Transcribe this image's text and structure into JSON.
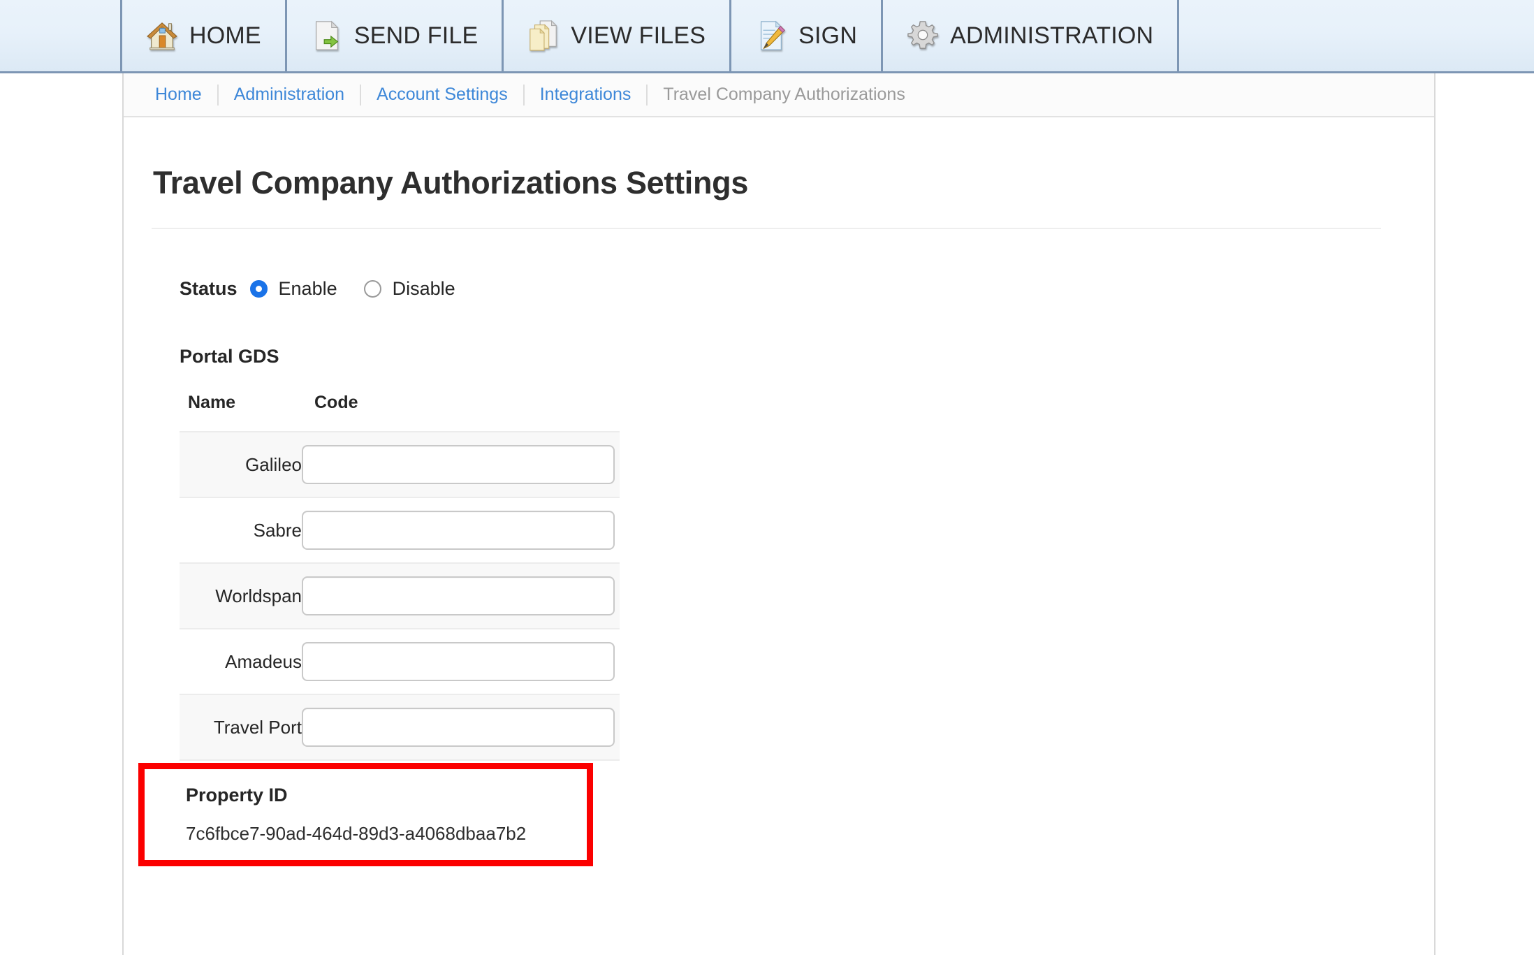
{
  "topnav": {
    "tabs": [
      {
        "label": "HOME",
        "icon": "house-icon"
      },
      {
        "label": "SEND FILE",
        "icon": "document-arrow-icon"
      },
      {
        "label": "VIEW FILES",
        "icon": "documents-stack-icon"
      },
      {
        "label": "SIGN",
        "icon": "document-pencil-icon"
      },
      {
        "label": "ADMINISTRATION",
        "icon": "gear-icon"
      }
    ]
  },
  "breadcrumb": {
    "items": [
      {
        "label": "Home",
        "current": false
      },
      {
        "label": "Administration",
        "current": false
      },
      {
        "label": "Account Settings",
        "current": false
      },
      {
        "label": "Integrations",
        "current": false
      },
      {
        "label": "Travel Company Authorizations",
        "current": true
      }
    ]
  },
  "page": {
    "title": "Travel Company Authorizations Settings"
  },
  "status": {
    "label": "Status",
    "options": [
      {
        "label": "Enable",
        "selected": true
      },
      {
        "label": "Disable",
        "selected": false
      }
    ]
  },
  "portal_gds": {
    "heading": "Portal GDS",
    "columns": [
      "Name",
      "Code"
    ],
    "rows": [
      {
        "name": "Galileo",
        "code": "",
        "placeholder": ""
      },
      {
        "name": "Sabre",
        "code": "",
        "placeholder": ""
      },
      {
        "name": "Worldspan",
        "code": "",
        "placeholder": ""
      },
      {
        "name": "Amadeus",
        "code": "",
        "placeholder": ""
      },
      {
        "name": "Travel Port",
        "code": "",
        "placeholder": ""
      }
    ]
  },
  "property_id": {
    "label": "Property ID",
    "value": "7c6fbce7-90ad-464d-89d3-a4068dbaa7b2",
    "highlight_color": "#fb0000"
  },
  "colors": {
    "nav_background": "#e7f1fa",
    "nav_border": "#7d96b4",
    "link": "#3d87d8",
    "muted_text": "#9a9a9a",
    "radio_selected": "#1a73e8",
    "row_alt": "#f8f8f8"
  }
}
